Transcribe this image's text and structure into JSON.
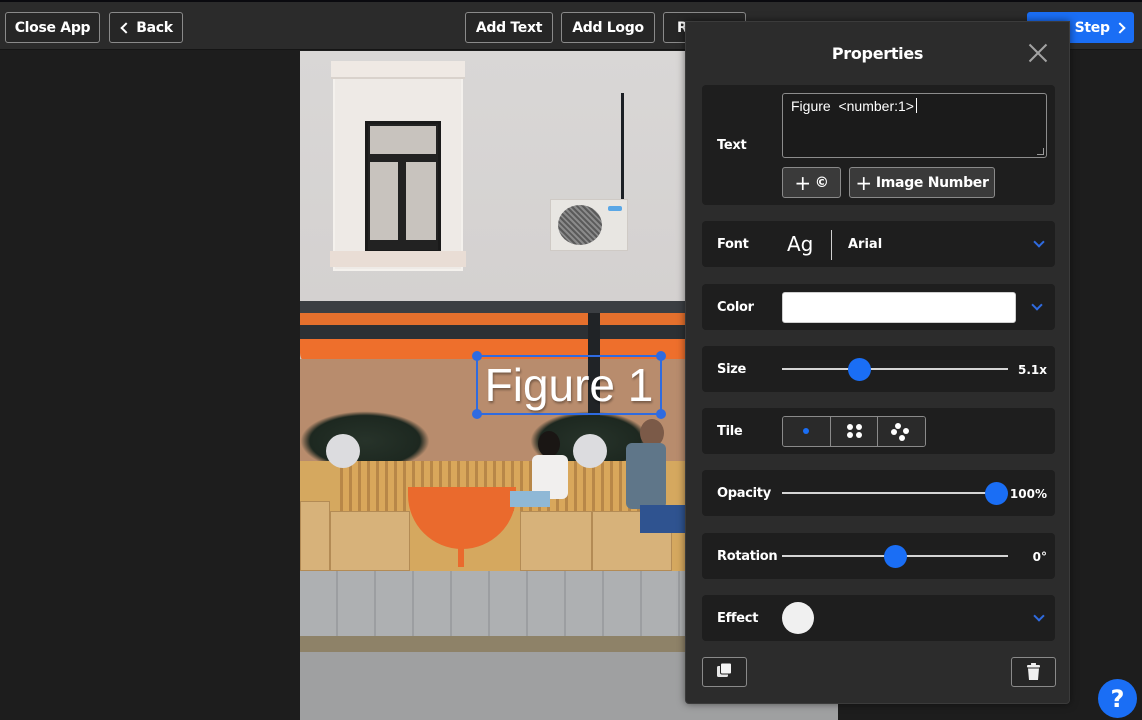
{
  "toolbar": {
    "close_app_label": "Close App",
    "back_label": "Back",
    "add_text_label": "Add Text",
    "add_logo_label": "Add Logo",
    "third_button_label_visible": "R",
    "next_step_label": "Next Step",
    "accent_color": "#1a6ef5"
  },
  "canvas": {
    "overlay_text": "Figure 1",
    "selection_color": "#2f6be0"
  },
  "properties_panel": {
    "title": "Properties",
    "close_icon": "close-x-icon",
    "text": {
      "label": "Text",
      "value": "Figure  <number:1>",
      "add_copyright_label": "©",
      "add_image_number_label": "Image Number"
    },
    "font": {
      "label": "Font",
      "preview": "Ag",
      "selected": "Arial"
    },
    "color": {
      "label": "Color",
      "value": "#ffffff"
    },
    "size": {
      "label": "Size",
      "value_text": "5.1x",
      "fraction": 0.34
    },
    "tile": {
      "label": "Tile",
      "options": [
        "single",
        "grid",
        "diamond"
      ],
      "selected": "single"
    },
    "opacity": {
      "label": "Opacity",
      "value_text": "100%",
      "fraction": 1.0
    },
    "rotation": {
      "label": "Rotation",
      "value_text": "0°",
      "fraction": 0.5
    },
    "effect": {
      "label": "Effect",
      "value": "#f0f0f0"
    },
    "footer": {
      "duplicate_icon": "duplicate-icon",
      "delete_icon": "trash-icon"
    }
  },
  "help": {
    "label": "?"
  }
}
